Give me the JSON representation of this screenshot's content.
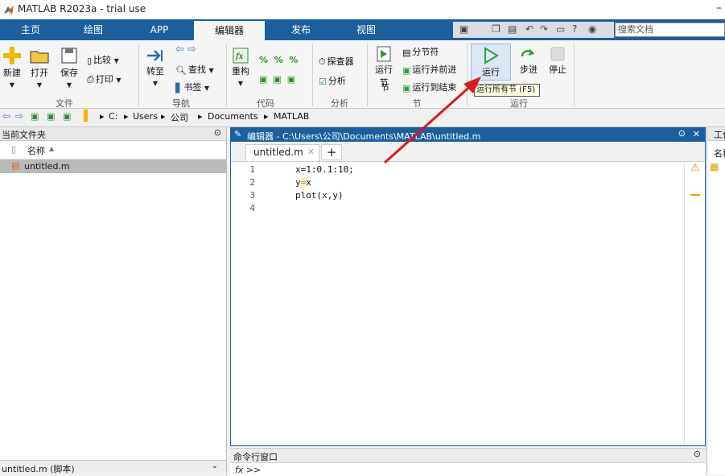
{
  "window": {
    "title": "MATLAB R2023a - trial use",
    "minimize_glyph": "–"
  },
  "tabs": [
    {
      "label": "主页",
      "active": false
    },
    {
      "label": "绘图",
      "active": false
    },
    {
      "label": "APP",
      "active": false
    },
    {
      "label": "编辑器",
      "active": true
    },
    {
      "label": "发布",
      "active": false
    },
    {
      "label": "视图",
      "active": false
    }
  ],
  "search": {
    "placeholder": "搜索文档"
  },
  "ribbon": {
    "file": {
      "new": "新建",
      "open": "打开",
      "save": "保存",
      "compare": "比较",
      "print": "打印",
      "group": "文件"
    },
    "navigate": {
      "goto": "转至",
      "find": "查找",
      "bookmark": "书签",
      "group": "导航"
    },
    "code": {
      "refactor": "重构",
      "group": "代码"
    },
    "analyze": {
      "inspector": "探查器",
      "analyze": "分析",
      "group": "分析"
    },
    "section": {
      "run_section": "运行节",
      "run_section_line2": "节",
      "section_break": "分节符",
      "run_advance": "运行并前进",
      "run_to_end": "运行到结束",
      "group": "节"
    },
    "run": {
      "run": "运行",
      "step": "步进",
      "stop": "停止",
      "group": "运行"
    }
  },
  "tooltip": "运行所有节 (F5)",
  "address": {
    "drive": "C:",
    "parts": [
      "Users",
      "公司",
      "Documents",
      "MATLAB"
    ]
  },
  "current_folder": {
    "title": "当前文件夹",
    "column_name": "名称",
    "sort_glyph": "▲",
    "files": [
      "untitled.m"
    ],
    "footer": "untitled.m (脚本)"
  },
  "editor": {
    "header": "编辑器 - C:\\Users\\公司\\Documents\\MATLAB\\untitled.m",
    "tab_label": "untitled.m",
    "plus": "+",
    "lines": [
      {
        "n": "1",
        "code": "x=1:0.1:10;"
      },
      {
        "n": "2",
        "code": "y=x"
      },
      {
        "n": "3",
        "code": "plot(x,y)"
      },
      {
        "n": "4",
        "code": ""
      }
    ],
    "warning_color": "#f0a000"
  },
  "command_window": {
    "title": "命令行窗口",
    "prompt": "fx >>"
  },
  "workspace": {
    "title": "工作",
    "col": "名称"
  },
  "colors": {
    "accent": "#1b5f9e",
    "run_green": "#2e9e3a",
    "arrow_red": "#d81b1b"
  }
}
